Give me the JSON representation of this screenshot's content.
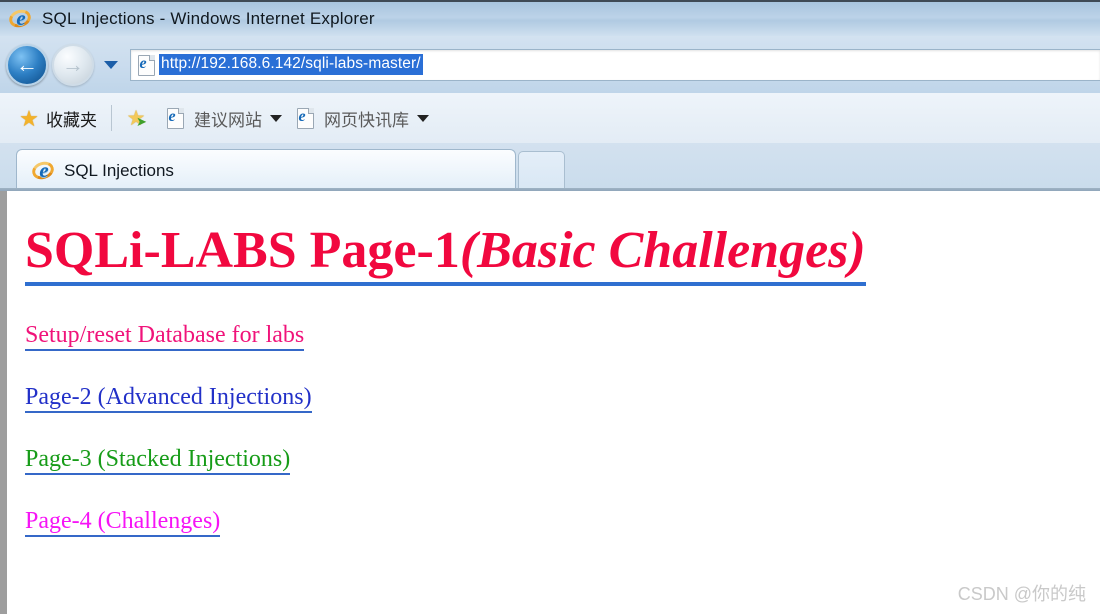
{
  "window": {
    "title": "SQL Injections - Windows Internet Explorer",
    "app_icon": "ie-logo-icon"
  },
  "navigation": {
    "back_label": "←",
    "back_icon": "back-arrow-icon",
    "forward_label": "→",
    "forward_icon": "forward-arrow-icon",
    "recent_pages_icon": "chevron-down-icon",
    "address": {
      "icon": "page-favicon-icon",
      "value": "http://192.168.6.142/sqli-labs-master/",
      "placeholder": "",
      "selected": true
    }
  },
  "favorites_bar": {
    "favorites": {
      "icon": "star-icon",
      "label": "收藏夹"
    },
    "items": [
      {
        "icon": "star-add-icon",
        "label": "",
        "has_caret": false
      },
      {
        "icon": "page-favicon-icon",
        "label": "建议网站",
        "has_caret": true
      },
      {
        "icon": "page-favicon-icon",
        "label": "网页快讯库",
        "has_caret": true
      }
    ]
  },
  "tabs": {
    "items": [
      {
        "icon": "ie-logo-icon",
        "label": "SQL Injections",
        "active": true
      }
    ],
    "new_tab_label": ""
  },
  "page": {
    "heading": {
      "main": "SQLi-LABS Page-1",
      "italic": "(Basic Challenges)",
      "color": "#f1083f",
      "underline_color": "#2f6fd0"
    },
    "links": [
      {
        "label": "Setup/reset Database for labs",
        "color": "#f0137a"
      },
      {
        "label": "Page-2 (Advanced Injections)",
        "color": "#2230c8"
      },
      {
        "label": "Page-3 (Stacked Injections)",
        "color": "#179c18"
      },
      {
        "label": "Page-4 (Challenges)",
        "color": "#f613f6"
      }
    ],
    "watermark": "CSDN @你的纯"
  }
}
